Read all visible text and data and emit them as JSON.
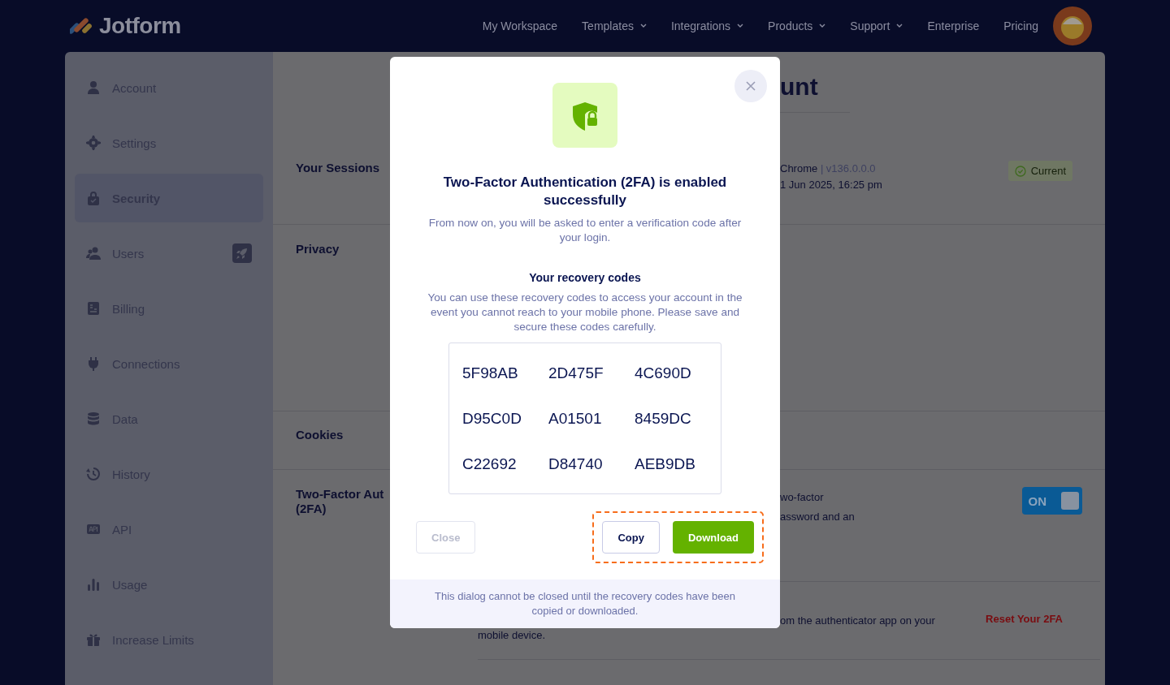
{
  "header": {
    "logo": "Jotform",
    "nav": [
      {
        "label": "My Workspace",
        "dropdown": false
      },
      {
        "label": "Templates",
        "dropdown": true
      },
      {
        "label": "Integrations",
        "dropdown": true
      },
      {
        "label": "Products",
        "dropdown": true
      },
      {
        "label": "Support",
        "dropdown": true
      },
      {
        "label": "Enterprise",
        "dropdown": false
      },
      {
        "label": "Pricing",
        "dropdown": false
      }
    ]
  },
  "sidebar": {
    "items": [
      {
        "label": "Account",
        "selected": false,
        "badge": false
      },
      {
        "label": "Settings",
        "selected": false,
        "badge": false
      },
      {
        "label": "Security",
        "selected": true,
        "badge": false
      },
      {
        "label": "Users",
        "selected": false,
        "badge": true
      },
      {
        "label": "Billing",
        "selected": false,
        "badge": false
      },
      {
        "label": "Connections",
        "selected": false,
        "badge": false
      },
      {
        "label": "Data",
        "selected": false,
        "badge": false
      },
      {
        "label": "History",
        "selected": false,
        "badge": false
      },
      {
        "label": "API",
        "selected": false,
        "badge": false
      },
      {
        "label": "Usage",
        "selected": false,
        "badge": false
      },
      {
        "label": "Increase Limits",
        "selected": false,
        "badge": false
      }
    ]
  },
  "content": {
    "heading": "unt",
    "sessions": {
      "label": "Your Sessions",
      "browser": "Chrome",
      "version": "| v136.0.0.0",
      "date": "1 Jun 2025, 16:25 pm",
      "status": "Current"
    },
    "privacy": {
      "label": "Privacy"
    },
    "cookies": {
      "label": "Cookies"
    },
    "two_factor": {
      "label_lines": [
        "Two-Factor Aut",
        "(2FA)"
      ],
      "description_lines": [
        "wo-factor",
        "assword and an"
      ],
      "toggle": {
        "label": "ON",
        "on": true
      },
      "reset": {
        "text_lines": [
          "om the authenticator app on your",
          "mobile device."
        ],
        "link": "Reset Your 2FA"
      }
    }
  },
  "modal": {
    "title": "Two-Factor Authentication (2FA) is enabled successfully",
    "message": "From now on, you will be asked to enter a verification code after your login.",
    "codes_heading": "Your recovery codes",
    "codes_text": "You can use these recovery codes to access your account in the event you cannot reach to your mobile phone. Please save and secure these codes carefully.",
    "codes": [
      "5F98AB",
      "2D475F",
      "4C690D",
      "D95C0D",
      "A01501",
      "8459DC",
      "C22692",
      "D84740",
      "AEB9DB"
    ],
    "buttons": {
      "close": {
        "label": "Close",
        "disabled": true
      },
      "copy": {
        "label": "Copy"
      },
      "download": {
        "label": "Download"
      },
      "actions_highlighted": true
    },
    "note": "This dialog cannot be closed until the recovery codes have been copied or downloaded."
  }
}
